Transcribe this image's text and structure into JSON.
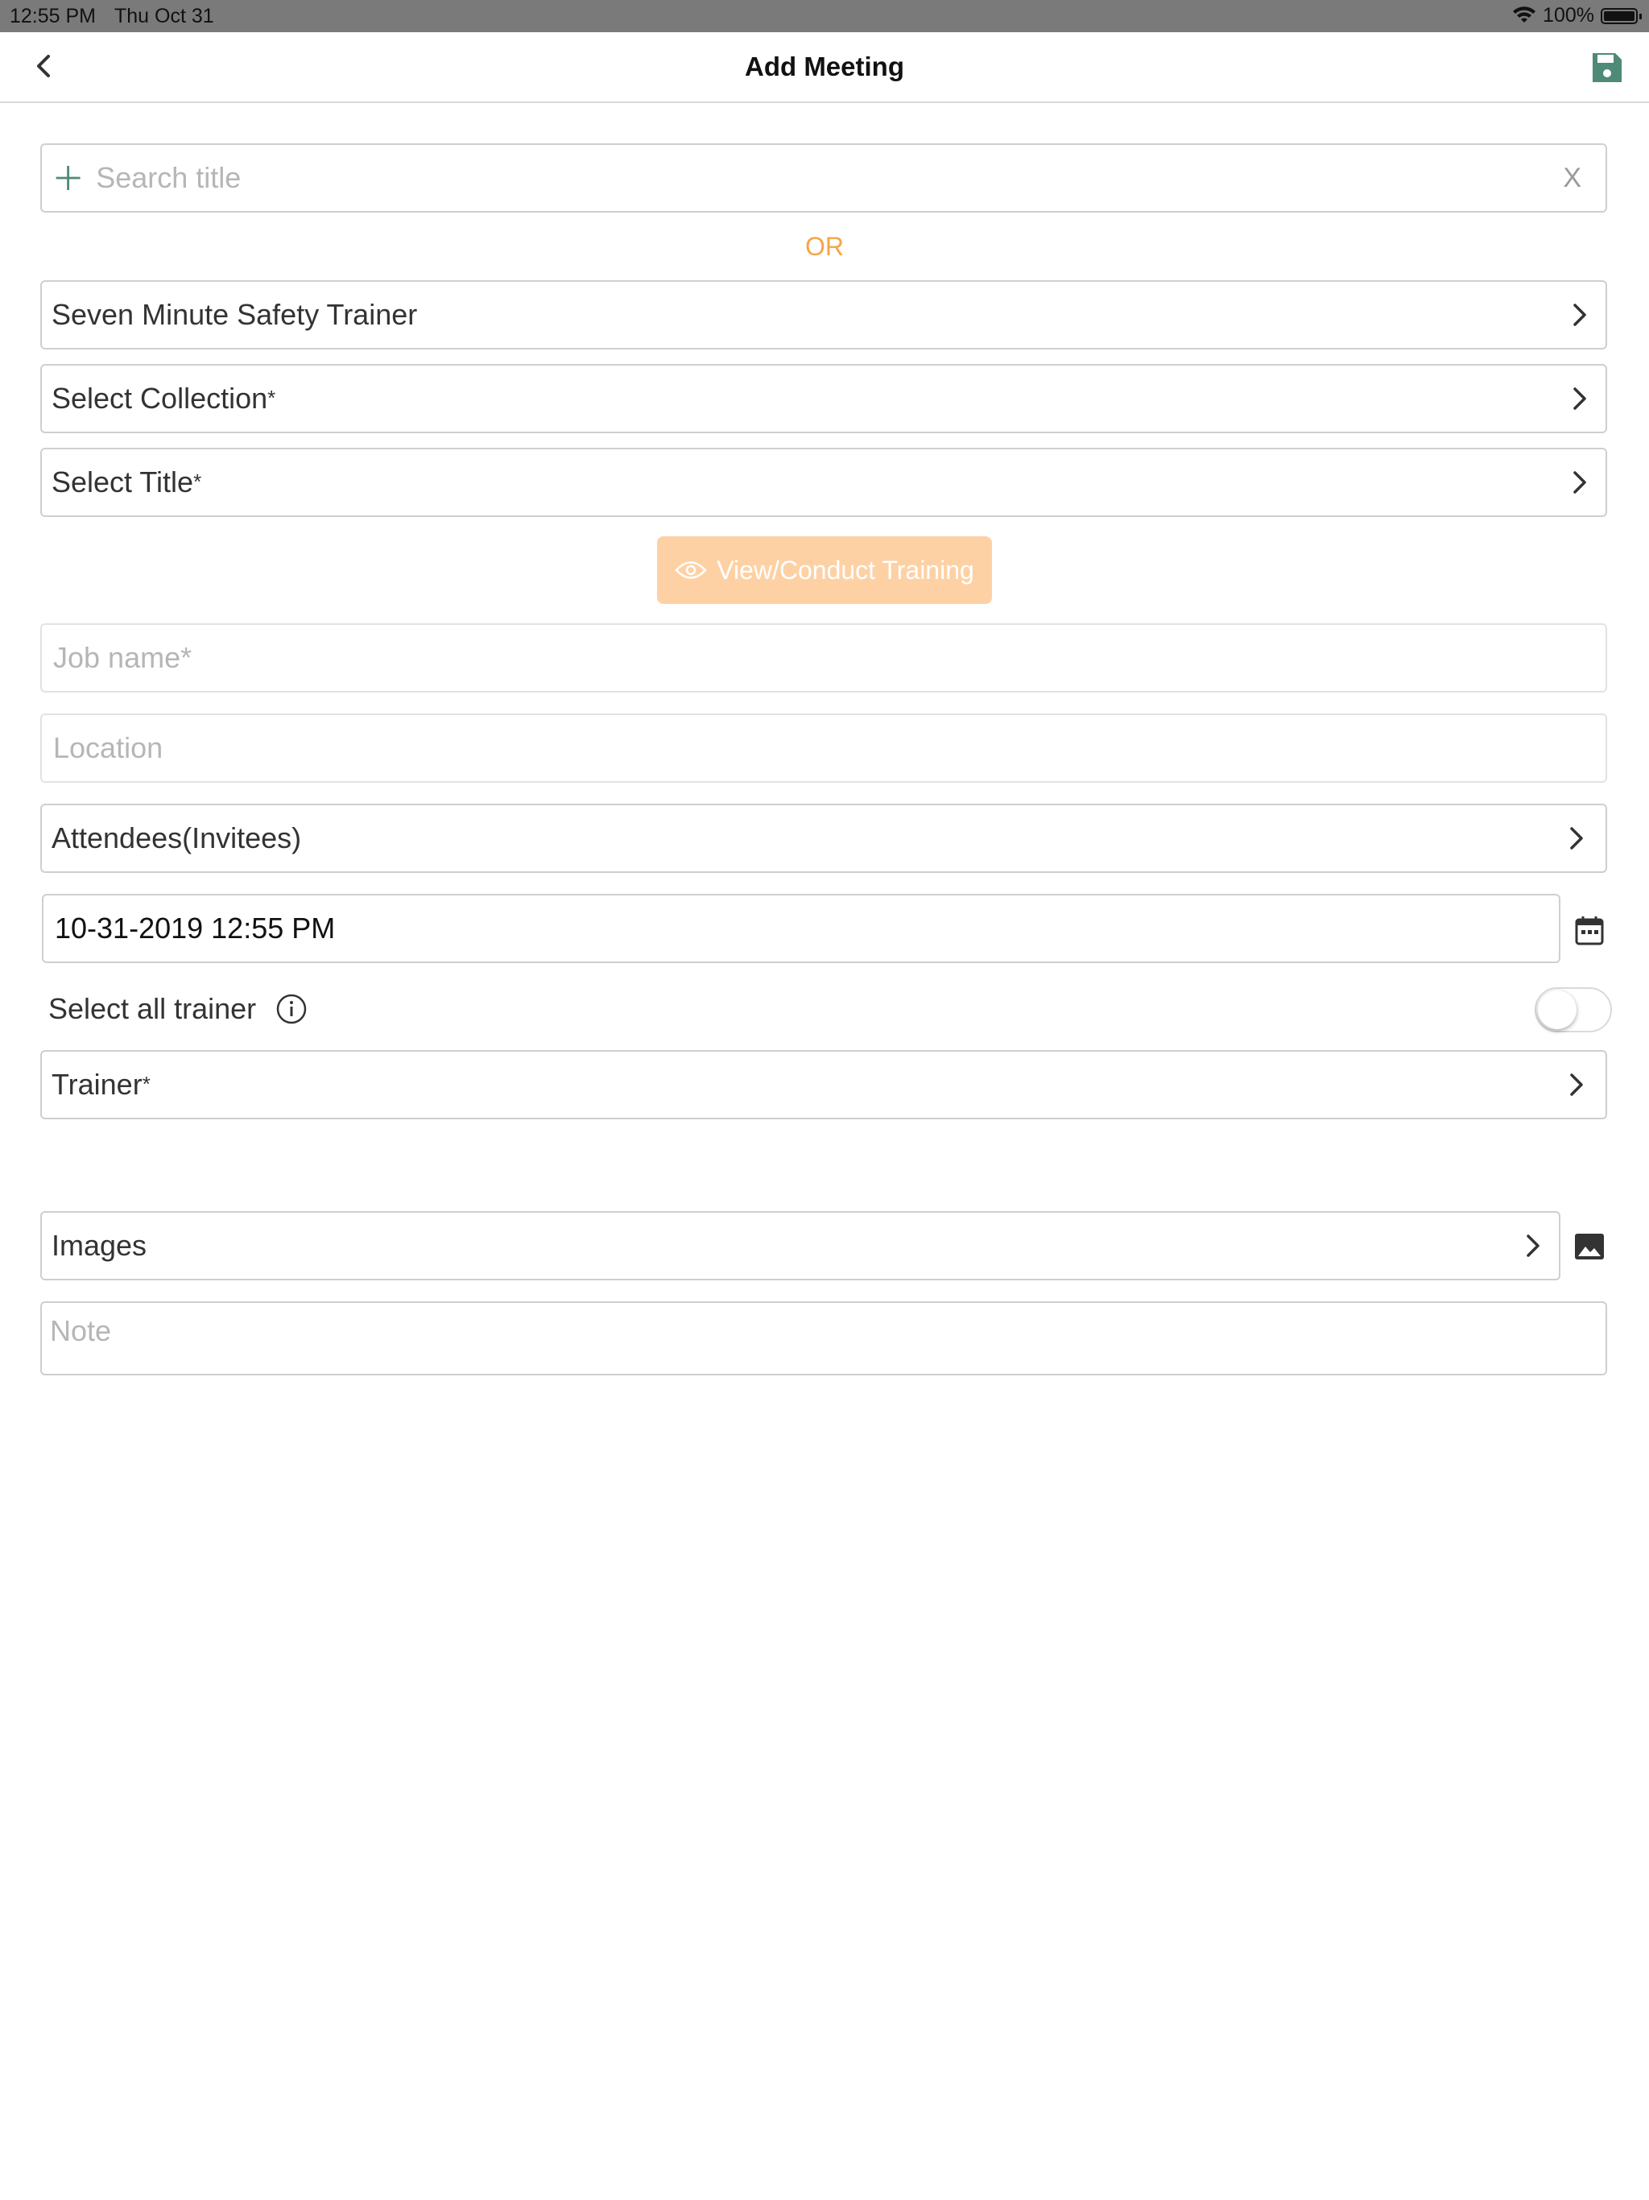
{
  "status_bar": {
    "time": "12:55 PM",
    "date": "Thu Oct 31",
    "battery": "100%"
  },
  "header": {
    "title": "Add Meeting"
  },
  "search": {
    "placeholder": "Search title",
    "clear_label": "X"
  },
  "or_label": "OR",
  "course_selector": {
    "value": "Seven Minute Safety Trainer"
  },
  "collection_selector": {
    "label": "Select Collection",
    "required_mark": "*"
  },
  "title_selector": {
    "label": "Select Title",
    "required_mark": "*"
  },
  "view_button": {
    "label": "View/Conduct Training"
  },
  "job_name": {
    "placeholder": "Job name*"
  },
  "location": {
    "placeholder": "Location"
  },
  "attendees": {
    "label": "Attendees(Invitees)"
  },
  "datetime": {
    "value": "10-31-2019 12:55 PM"
  },
  "select_all_trainer": {
    "label": "Select all trainer",
    "enabled": false
  },
  "trainer": {
    "label": "Trainer",
    "required_mark": "*"
  },
  "images": {
    "label": "Images"
  },
  "note": {
    "placeholder": "Note"
  },
  "colors": {
    "accent_green": "#4e8a77",
    "accent_orange": "#f5a545",
    "button_disabled": "#fed1a4"
  }
}
